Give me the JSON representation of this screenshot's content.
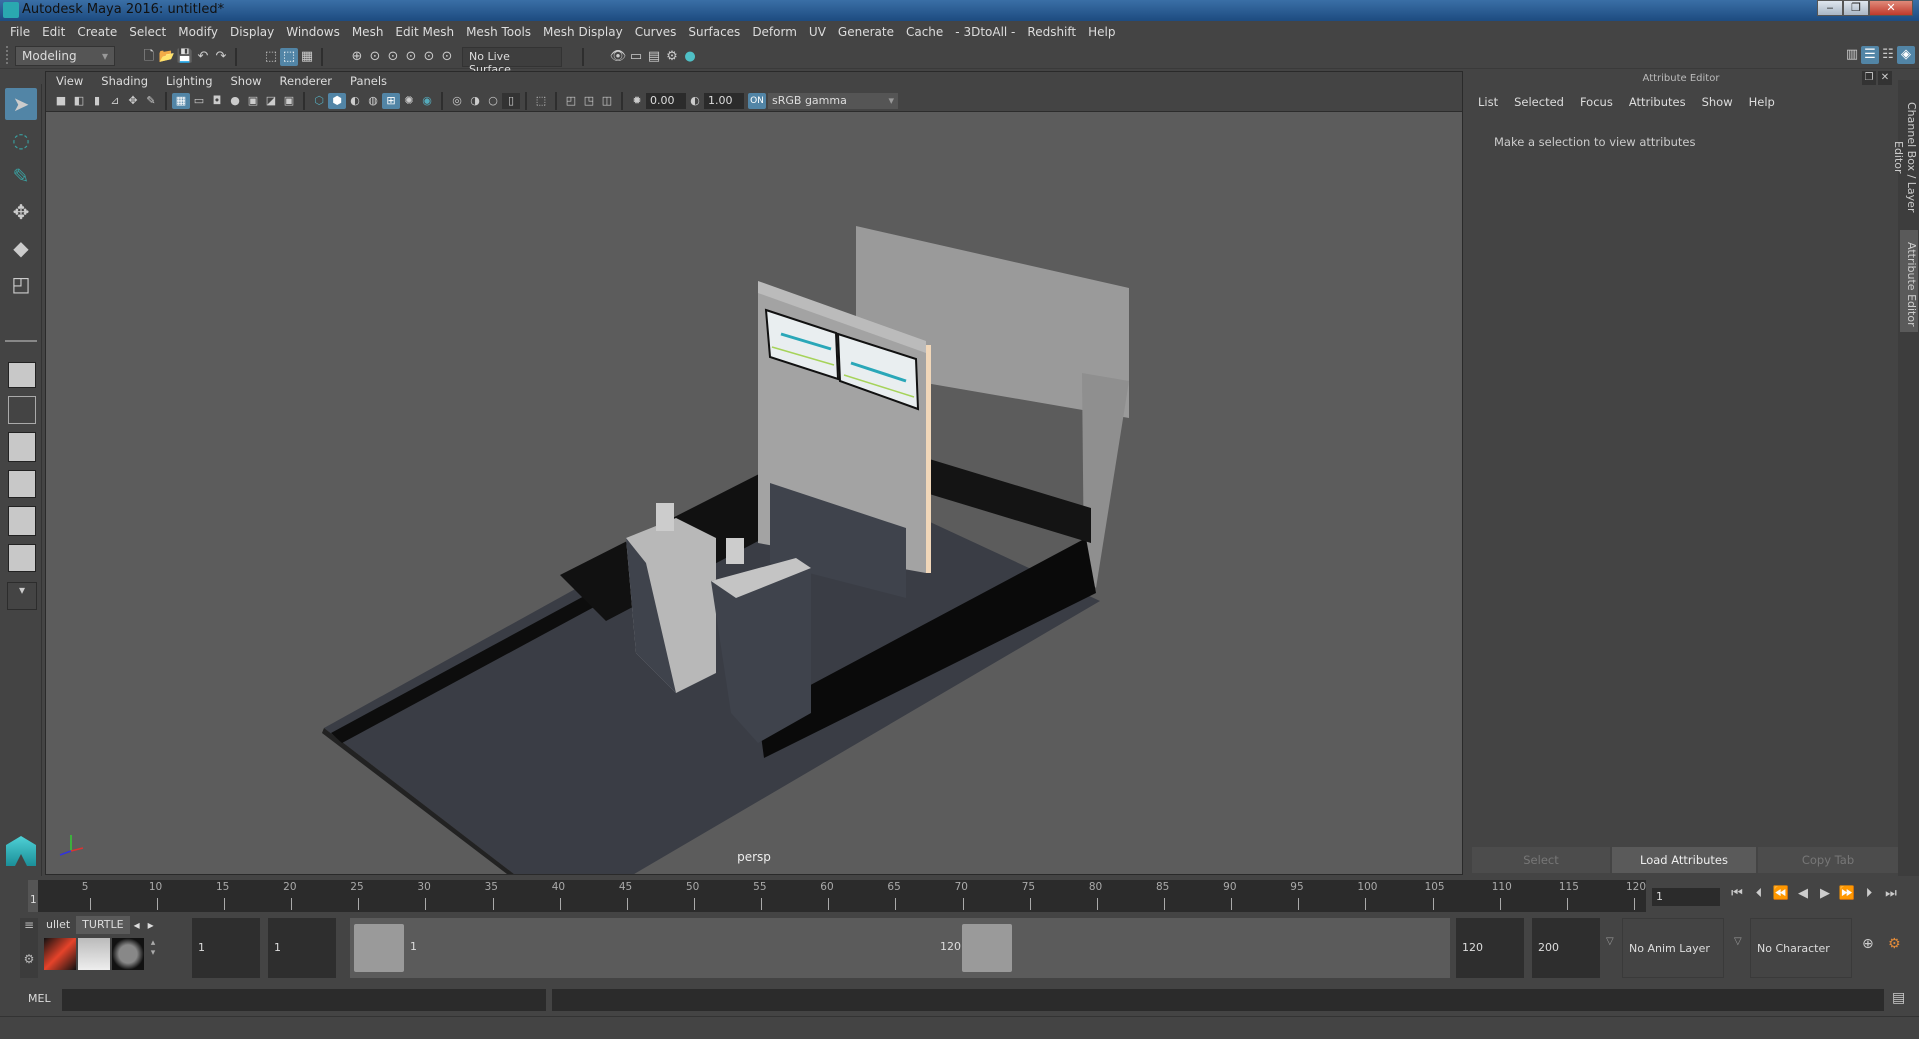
{
  "window": {
    "title": "Autodesk Maya 2016: untitled*",
    "buttons": [
      "minimize",
      "restore",
      "close"
    ]
  },
  "menubar": [
    "File",
    "Edit",
    "Create",
    "Select",
    "Modify",
    "Display",
    "Windows",
    "Mesh",
    "Edit Mesh",
    "Mesh Tools",
    "Mesh Display",
    "Curves",
    "Surfaces",
    "Deform",
    "UV",
    "Generate",
    "Cache",
    "- 3DtoAll -",
    "Redshift",
    "Help"
  ],
  "statusline": {
    "mode": "Modeling",
    "live_surface": "No Live Surface"
  },
  "panel": {
    "menu": [
      "View",
      "Shading",
      "Lighting",
      "Show",
      "Renderer",
      "Panels"
    ],
    "exposure": "0.00",
    "gamma": "1.00",
    "color_space": "sRGB gamma",
    "camera_label": "persp"
  },
  "attribute_editor": {
    "title": "Attribute Editor",
    "menu": [
      "List",
      "Selected",
      "Focus",
      "Attributes",
      "Show",
      "Help"
    ],
    "message": "Make a selection to view attributes",
    "buttons": {
      "select": "Select",
      "load": "Load Attributes",
      "copy": "Copy Tab"
    }
  },
  "side_tabs": {
    "channel_box": "Channel Box / Layer Editor",
    "attribute_editor": "Attribute Editor"
  },
  "timeline": {
    "ticks": [
      5,
      10,
      15,
      20,
      25,
      30,
      35,
      40,
      45,
      50,
      55,
      60,
      65,
      70,
      75,
      80,
      85,
      90,
      95,
      100,
      105,
      110,
      115,
      120
    ],
    "range_min": 1,
    "range_max": 120,
    "current_frame": "1",
    "start_label": "1"
  },
  "range": {
    "shelf_tabs": [
      "ullet",
      "TURTLE"
    ],
    "anim_start": "1",
    "playback_start": "1",
    "slider_start": "1",
    "slider_end": "120",
    "playback_end": "120",
    "anim_end": "200",
    "anim_layer": "No Anim Layer",
    "character_set": "No Character Set"
  },
  "command_line": {
    "language": "MEL",
    "input": "",
    "output": ""
  }
}
